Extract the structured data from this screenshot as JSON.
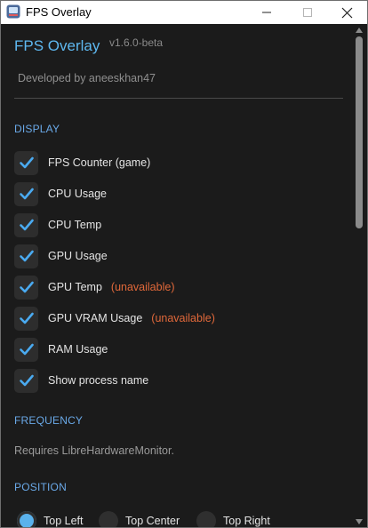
{
  "window": {
    "title": "FPS Overlay"
  },
  "header": {
    "title": "FPS Overlay",
    "version": "v1.6.0-beta",
    "developer": "Developed by aneeskhan47"
  },
  "display": {
    "heading": "DISPLAY",
    "items": [
      {
        "label": "FPS Counter (game)",
        "checked": true,
        "note": ""
      },
      {
        "label": "CPU Usage",
        "checked": true,
        "note": ""
      },
      {
        "label": "CPU Temp",
        "checked": true,
        "note": ""
      },
      {
        "label": "GPU Usage",
        "checked": true,
        "note": ""
      },
      {
        "label": "GPU Temp",
        "checked": true,
        "note": "(unavailable)"
      },
      {
        "label": "GPU VRAM Usage",
        "checked": true,
        "note": "(unavailable)"
      },
      {
        "label": "RAM Usage",
        "checked": true,
        "note": ""
      },
      {
        "label": "Show process name",
        "checked": true,
        "note": ""
      }
    ]
  },
  "frequency": {
    "heading": "FREQUENCY",
    "note": "Requires LibreHardwareMonitor."
  },
  "position": {
    "heading": "POSITION",
    "options": [
      {
        "label": "Top Left",
        "selected": true
      },
      {
        "label": "Top Center",
        "selected": false
      },
      {
        "label": "Top Right",
        "selected": false
      }
    ]
  },
  "colors": {
    "accent": "#5eb8f0",
    "check": "#4aaaf0",
    "warning": "#e0683a",
    "background": "#1b1b1b"
  },
  "icons": {
    "app": "app-icon",
    "minimize": "minimize-icon",
    "maximize": "maximize-icon",
    "close": "close-icon",
    "check": "checkmark-icon"
  }
}
